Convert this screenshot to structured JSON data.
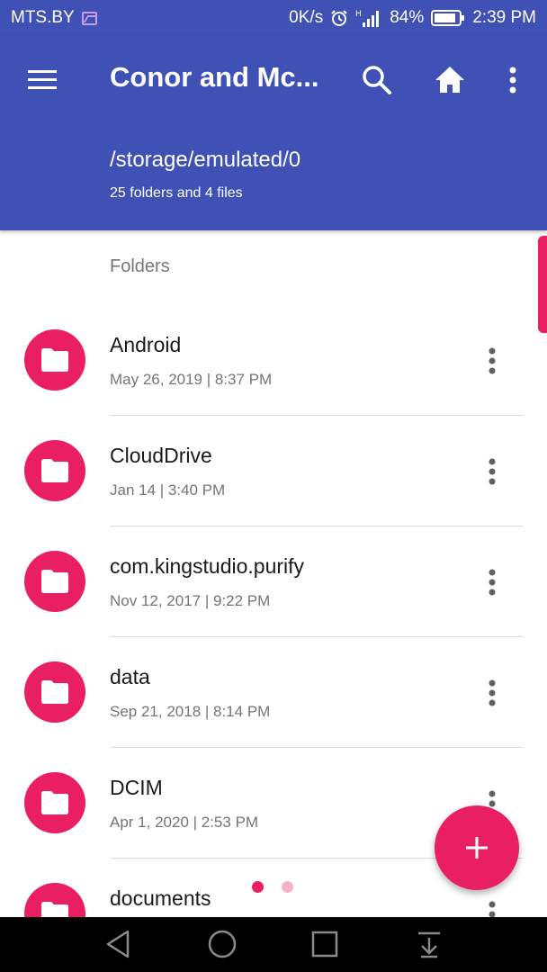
{
  "status_bar": {
    "carrier": "MTS.BY",
    "network_speed": "0K/s",
    "network_type": "H",
    "battery": "84%",
    "time": "2:39 PM"
  },
  "app_bar": {
    "title": "Conor and Mc...",
    "path": "/storage/emulated/0",
    "summary": "25 folders and 4 files",
    "icons": [
      "menu-icon",
      "search-icon",
      "home-icon",
      "more-vert-icon"
    ]
  },
  "section": {
    "header": "Folders"
  },
  "items": [
    {
      "name": "Android",
      "date": "May 26, 2019 | 8:37 PM"
    },
    {
      "name": "CloudDrive",
      "date": "Jan 14 | 3:40 PM"
    },
    {
      "name": "com.kingstudio.purify",
      "date": "Nov 12, 2017 | 9:22 PM"
    },
    {
      "name": "data",
      "date": "Sep 21, 2018 | 8:14 PM"
    },
    {
      "name": "DCIM",
      "date": "Apr 1, 2020 | 2:53 PM"
    },
    {
      "name": "documents",
      "date": ""
    }
  ],
  "pager": {
    "pages": 2,
    "current": 1
  },
  "colors": {
    "primary": "#3f51b5",
    "accent": "#e91e63"
  }
}
